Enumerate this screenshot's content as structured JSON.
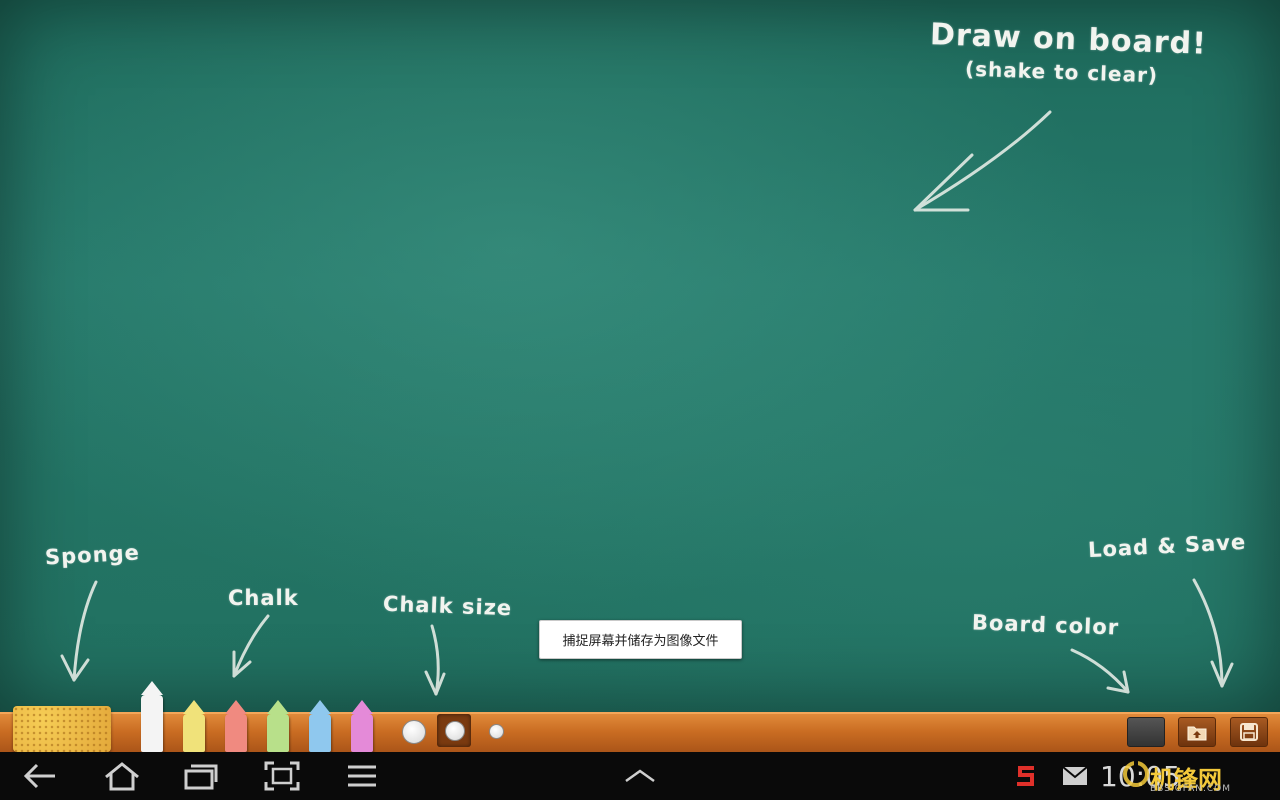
{
  "board": {
    "title": "Draw on board!",
    "subtitle": "(shake to clear)",
    "labels": {
      "sponge": "Sponge",
      "chalk": "Chalk",
      "chalk_size": "Chalk size",
      "board_color": "Board color",
      "load_save": "Load & Save"
    }
  },
  "toast": {
    "text": "捕捉屏幕并储存为图像文件"
  },
  "tray": {
    "chalks": [
      {
        "name": "white",
        "color": "#f4f4f4"
      },
      {
        "name": "yellow",
        "color": "#f0e27a"
      },
      {
        "name": "red",
        "color": "#f08a80"
      },
      {
        "name": "green",
        "color": "#b8e08a"
      },
      {
        "name": "blue",
        "color": "#8fc8ee"
      },
      {
        "name": "pink",
        "color": "#e48ad8"
      }
    ],
    "sizes": [
      "large",
      "medium",
      "small"
    ],
    "selected_size": "medium"
  },
  "status": {
    "clock": "10:05",
    "watermark": "机锋网",
    "watermark_url": "BBS.GFAN.COM"
  }
}
